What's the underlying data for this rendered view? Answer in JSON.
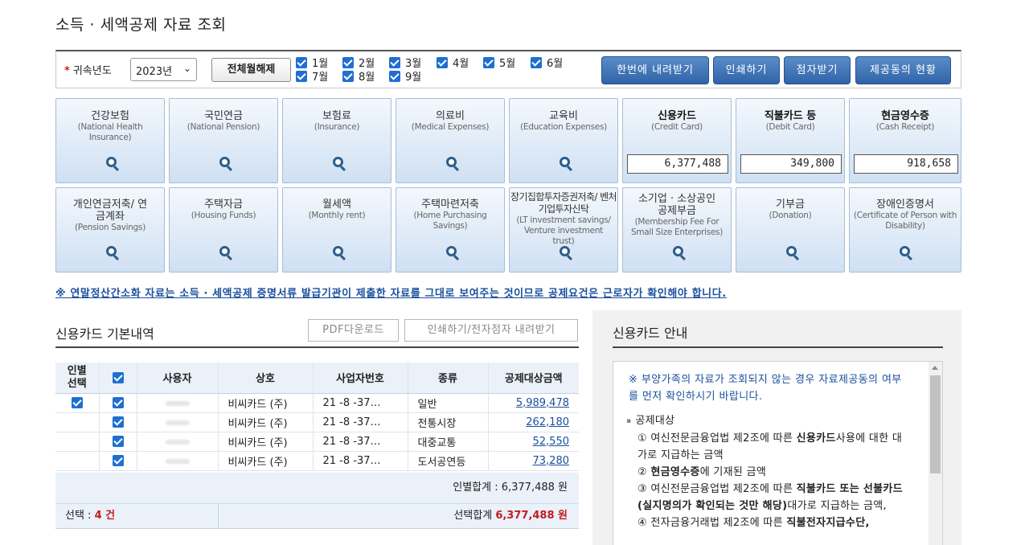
{
  "page_title": "소득 · 세액공제 자료 조회",
  "filter": {
    "required_mark": "*",
    "year_label": "귀속년도",
    "year_value": "2023년",
    "unselect_all_label": "전체월해제",
    "months": [
      "1월",
      "2월",
      "3월",
      "4월",
      "5월",
      "6월",
      "7월",
      "8월",
      "9월"
    ]
  },
  "actions": {
    "download_all": "한번에 내려받기",
    "print": "인쇄하기",
    "e_receive": "점자받기",
    "provider_status": "제공동의 현황"
  },
  "tiles_row1": [
    {
      "ko": "건강보험",
      "en": "(National Health Insurance)"
    },
    {
      "ko": "국민연금",
      "en": "(National Pension)"
    },
    {
      "ko": "보험료",
      "en": "(Insurance)"
    },
    {
      "ko": "의료비",
      "en": "(Medical Expenses)"
    },
    {
      "ko": "교육비",
      "en": "(Education Expenses)"
    },
    {
      "ko": "신용카드",
      "en": "(Credit Card)",
      "amount": "6,377,488"
    },
    {
      "ko": "직불카드 등",
      "en": "(Debit Card)",
      "amount": "349,800"
    },
    {
      "ko": "현금영수증",
      "en": "(Cash Receipt)",
      "amount": "918,658"
    }
  ],
  "tiles_row2": [
    {
      "ko": "개인연금저축/ 연금계좌",
      "en": "(Pension Savings)"
    },
    {
      "ko": "주택자금",
      "en": "(Housing Funds)"
    },
    {
      "ko": "월세액",
      "en": "(Monthly rent)"
    },
    {
      "ko": "주택마련저축",
      "en": "(Home Purchasing Savings)"
    },
    {
      "ko": "장기집합투자증권저축/ 벤처기업투자신탁",
      "en": "(LT investment savings/ Venture investment trust)"
    },
    {
      "ko": "소기업 · 소상공인 공제부금",
      "en": "(Membership Fee For Small Size Enterprises)"
    },
    {
      "ko": "기부금",
      "en": "(Donation)"
    },
    {
      "ko": "장애인증명서",
      "en": "(Certificate of Person with Disability)"
    }
  ],
  "notice": "※ 연말정산간소화 자료는 소득 · 세액공제 증명서류 발급기관이 제출한 자료를 그대로 보여주는 것이므로 공제요건은 근로자가 확인해야 합니다.",
  "card_section": {
    "title": "신용카드 기본내역",
    "pdf_btn": "PDF다운로드",
    "print_btn": "인쇄하기/전자점자 내려받기",
    "headers": {
      "individual_select": "인별 선택",
      "user": "사용자",
      "company": "상호",
      "biz_no": "사업자번호",
      "type": "종류",
      "amount": "공제대상금액"
    },
    "rows": [
      {
        "company": "비씨카드 (주)",
        "biz_no": "21 -8 -37…",
        "type": "일반",
        "amount": "5,989,478"
      },
      {
        "company": "비씨카드 (주)",
        "biz_no": "21 -8 -37…",
        "type": "전통시장",
        "amount": "262,180"
      },
      {
        "company": "비씨카드 (주)",
        "biz_no": "21 -8 -37…",
        "type": "대중교통",
        "amount": "52,550"
      },
      {
        "company": "비씨카드 (주)",
        "biz_no": "21 -8 -37…",
        "type": "도서공연등",
        "amount": "73,280"
      }
    ],
    "individual_total_label": "인별합계 :",
    "individual_total_value": "6,377,488 원",
    "selected_label": "선택 :",
    "selected_count": "4 건",
    "selected_total_label": "선택합계",
    "selected_total_value": "6,377,488 원"
  },
  "guide": {
    "title": "신용카드 안내",
    "notice": "※ 부양가족의 자료가 조회되지 않는 경우 자료제공동의 여부를 먼저 확인하시기 바랍니다.",
    "header": "공제대상",
    "items": [
      {
        "pre": "① 여신전문금융업법 제2조에 따른 ",
        "bold": "신용카드",
        "post": "사용에 대한 대가로 지급하는 금액"
      },
      {
        "pre": "② ",
        "bold": "현금영수증",
        "post": "에 기재된 금액"
      },
      {
        "pre": "③ 여신전문금융업법 제2조에 따른 ",
        "bold": "직불카드 또는 선불카드(실지명의가 확인되는 것만 해당)",
        "post": "대가로 지급하는 금액,"
      },
      {
        "pre": "④ 전자금융거래법 제2조에 따른 ",
        "bold": "직불전자지급수단,",
        "post": ""
      }
    ]
  }
}
